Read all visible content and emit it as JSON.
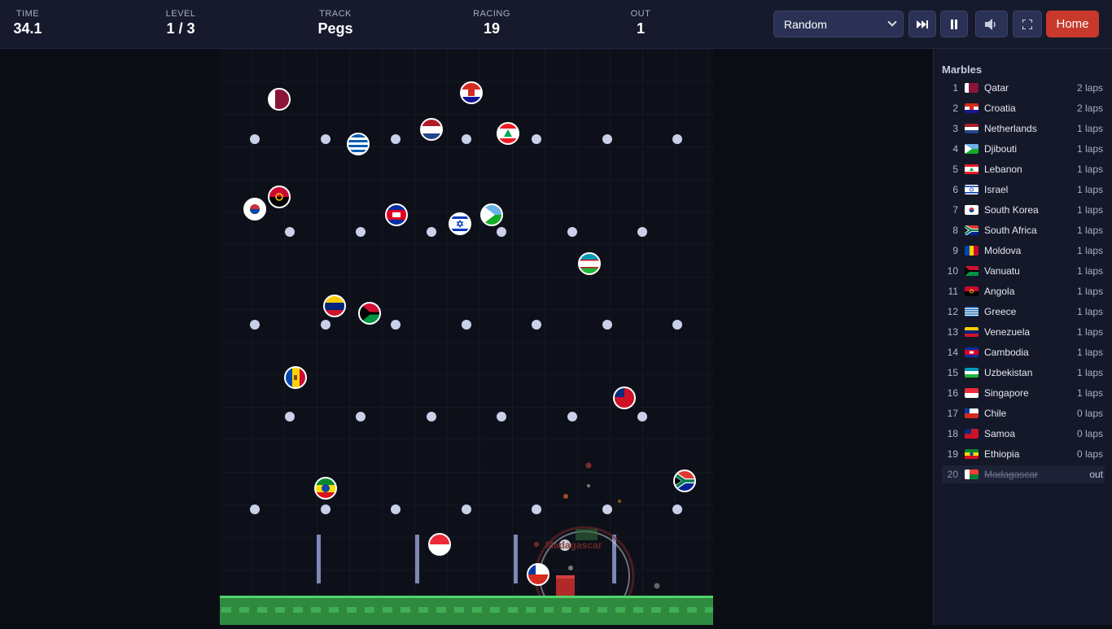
{
  "hud": {
    "time_label": "TIME",
    "time_value": "34.1",
    "level_label": "LEVEL",
    "level_value": "1 / 3",
    "track_label": "TRACK",
    "track_value": "Pegs",
    "racing_label": "RACING",
    "racing_value": "19",
    "out_label": "OUT",
    "out_value": "1"
  },
  "controls": {
    "mode_select": "Random",
    "skip_icon": "skip-forward-icon",
    "pause_icon": "pause-icon",
    "sound_icon": "volume-icon",
    "fullscreen_icon": "fullscreen-icon",
    "home_label": "Home"
  },
  "colors": {
    "accent_red": "#c8392b",
    "ground_green": "#2e8a3f",
    "peg": "#c9d0e8"
  },
  "sidebar": {
    "title": "Marbles",
    "rows": [
      {
        "rank": "1",
        "name": "Qatar",
        "laps": "2 laps",
        "flag": "qatar"
      },
      {
        "rank": "2",
        "name": "Croatia",
        "laps": "2 laps",
        "flag": "croatia"
      },
      {
        "rank": "3",
        "name": "Netherlands",
        "laps": "1 laps",
        "flag": "netherlands"
      },
      {
        "rank": "4",
        "name": "Djibouti",
        "laps": "1 laps",
        "flag": "djibouti"
      },
      {
        "rank": "5",
        "name": "Lebanon",
        "laps": "1 laps",
        "flag": "lebanon"
      },
      {
        "rank": "6",
        "name": "Israel",
        "laps": "1 laps",
        "flag": "israel"
      },
      {
        "rank": "7",
        "name": "South Korea",
        "laps": "1 laps",
        "flag": "southkorea"
      },
      {
        "rank": "8",
        "name": "South Africa",
        "laps": "1 laps",
        "flag": "southafrica"
      },
      {
        "rank": "9",
        "name": "Moldova",
        "laps": "1 laps",
        "flag": "moldova"
      },
      {
        "rank": "10",
        "name": "Vanuatu",
        "laps": "1 laps",
        "flag": "vanuatu"
      },
      {
        "rank": "11",
        "name": "Angola",
        "laps": "1 laps",
        "flag": "angola"
      },
      {
        "rank": "12",
        "name": "Greece",
        "laps": "1 laps",
        "flag": "greece"
      },
      {
        "rank": "13",
        "name": "Venezuela",
        "laps": "1 laps",
        "flag": "venezuela"
      },
      {
        "rank": "14",
        "name": "Cambodia",
        "laps": "1 laps",
        "flag": "cambodia"
      },
      {
        "rank": "15",
        "name": "Uzbekistan",
        "laps": "1 laps",
        "flag": "uzbekistan"
      },
      {
        "rank": "16",
        "name": "Singapore",
        "laps": "1 laps",
        "flag": "singapore"
      },
      {
        "rank": "17",
        "name": "Chile",
        "laps": "0 laps",
        "flag": "chile"
      },
      {
        "rank": "18",
        "name": "Samoa",
        "laps": "0 laps",
        "flag": "samoa"
      },
      {
        "rank": "19",
        "name": "Ethiopia",
        "laps": "0 laps",
        "flag": "ethiopia"
      },
      {
        "rank": "20",
        "name": "Madagascar",
        "laps": "out",
        "flag": "madagascar",
        "out": true
      }
    ]
  },
  "game": {
    "eliminated_label": "Madagascar"
  }
}
